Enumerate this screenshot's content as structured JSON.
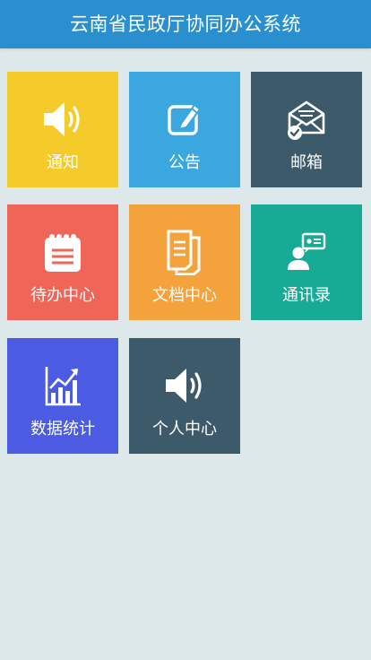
{
  "header": {
    "title": "云南省民政厅协同办公系统"
  },
  "colors": {
    "header_bg": "#2a8fcf",
    "page_bg": "#dde8ea",
    "notice": "#f5cb2c",
    "announcement": "#3aa7df",
    "mailbox": "#3c5a69",
    "todo": "#ef6659",
    "documents": "#f4a23c",
    "contacts": "#17ab96",
    "statistics": "#4b5ce3",
    "personal": "#3c5a69"
  },
  "tiles": [
    {
      "label": "通知",
      "icon": "speaker-icon"
    },
    {
      "label": "公告",
      "icon": "edit-note-icon"
    },
    {
      "label": "邮箱",
      "icon": "mail-check-icon"
    },
    {
      "label": "待办中心",
      "icon": "notepad-icon"
    },
    {
      "label": "文档中心",
      "icon": "documents-icon"
    },
    {
      "label": "通讯录",
      "icon": "contact-card-icon"
    },
    {
      "label": "数据统计",
      "icon": "chart-icon"
    },
    {
      "label": "个人中心",
      "icon": "speaker-icon"
    }
  ]
}
